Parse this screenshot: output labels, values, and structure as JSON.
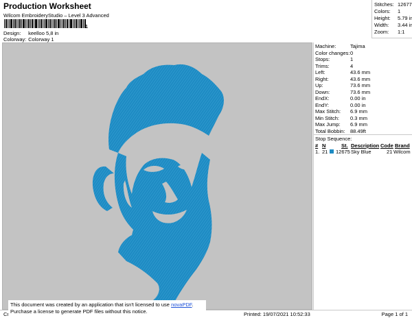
{
  "header": {
    "title": "Production Worksheet",
    "subtitle": "Wilcom EmbroideryStudio – Level 3 Advanced",
    "barcode_mark": "1",
    "design_label": "Design:",
    "design_value": "keelloo 5,8 in",
    "colorway_label": "Colorway:",
    "colorway_value": "Colorway 1"
  },
  "summary": {
    "stitches_label": "Stitches:",
    "stitches_value": "12677",
    "colors_label": "Colors:",
    "colors_value": "1",
    "height_label": "Height:",
    "height_value": "5.79 in",
    "width_label": "Width:",
    "width_value": "3.44 in",
    "zoom_label": "Zoom:",
    "zoom_value": "1:1"
  },
  "details": [
    {
      "label": "Machine:",
      "value": "Tajima"
    },
    {
      "label": "Color changes:",
      "value": "0"
    },
    {
      "label": "Stops:",
      "value": "1"
    },
    {
      "label": "Trims:",
      "value": "4"
    },
    {
      "label": "Left:",
      "value": "43.6 mm"
    },
    {
      "label": "Right:",
      "value": "43.6 mm"
    },
    {
      "label": "Up:",
      "value": "73.6 mm"
    },
    {
      "label": "Down:",
      "value": "73.6 mm"
    },
    {
      "label": "EndX:",
      "value": "0.00 in"
    },
    {
      "label": "EndY:",
      "value": "0.00 in"
    },
    {
      "label": "Max Stitch:",
      "value": "6.9 mm"
    },
    {
      "label": "Min Stitch:",
      "value": "0.3 mm"
    },
    {
      "label": "Max Jump:",
      "value": "6.9 mm"
    },
    {
      "label": "Total Bobbin:",
      "value": "88.49ft"
    }
  ],
  "stop_sequence": {
    "title": "Stop Sequence:",
    "columns": [
      "#",
      "N",
      "St.",
      "Description",
      "Code",
      "Brand"
    ],
    "rows": [
      {
        "index": "1.",
        "needle": "21",
        "stitches": "12675",
        "description": "Sky Blue",
        "code": "21",
        "brand": "Wilcom",
        "color": "#1e8bc3"
      }
    ]
  },
  "footer": {
    "left": "Cr",
    "printed": "Printed: 19/07/2021 10:52:33",
    "page": "Page 1 of 1"
  },
  "notice": {
    "line1": "This document was created by an application that isn't licensed to use",
    "link": "novaPDF",
    "line1_end": ".",
    "line2": "Purchase a license to generate PDF files without this notice."
  },
  "colors": {
    "thread": "#1e8bc3",
    "canvas": "#c3c3c3"
  }
}
